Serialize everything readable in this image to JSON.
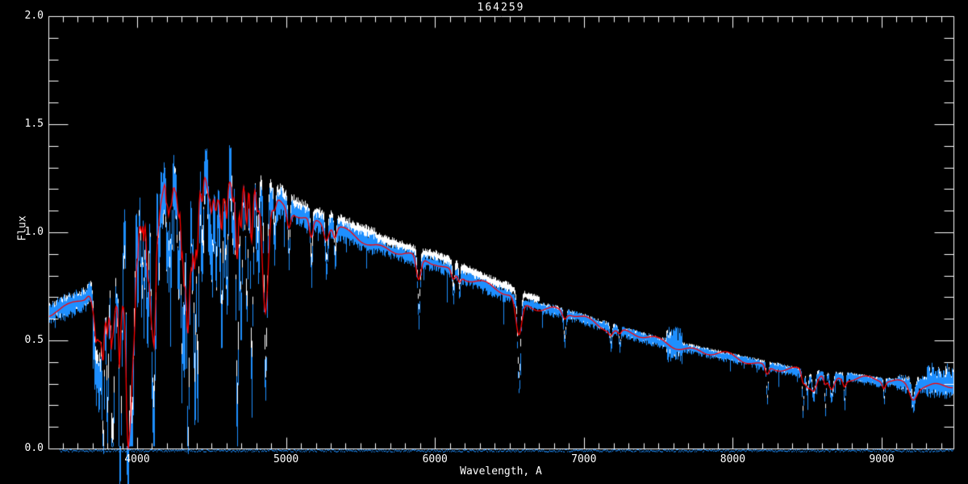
{
  "colors": {
    "background": "#000000",
    "axis": "#ffffff",
    "observed": "#1e8fff",
    "template": "#ffffff",
    "model": "#ff0000",
    "residual": "#1e8fff"
  },
  "chart_data": {
    "type": "line",
    "title": "164259",
    "xlabel": "Wavelength, A",
    "ylabel": "Flux",
    "xlim": [
      3404,
      9482
    ],
    "ylim": [
      0.0,
      2.0
    ],
    "grid": false,
    "x_major_ticks": [
      {
        "value": 4000,
        "label": "4000"
      },
      {
        "value": 5000,
        "label": "5000"
      },
      {
        "value": 6000,
        "label": "6000"
      },
      {
        "value": 7000,
        "label": "7000"
      },
      {
        "value": 8000,
        "label": "8000"
      },
      {
        "value": 9000,
        "label": "9000"
      }
    ],
    "x_minor_step": 100,
    "y_major_ticks": [
      {
        "value": 0.0,
        "label": "0.0"
      },
      {
        "value": 0.5,
        "label": "0.5"
      },
      {
        "value": 1.0,
        "label": "1.0"
      },
      {
        "value": 1.5,
        "label": "1.5"
      },
      {
        "value": 2.0,
        "label": "2.0"
      }
    ],
    "y_minor_step": 0.1,
    "series": [
      {
        "name": "observed-spectrum",
        "color": "#1e8fff",
        "style": "noisy"
      },
      {
        "name": "template-spectrum",
        "color": "#ffffff",
        "style": "noisy"
      },
      {
        "name": "model-fit",
        "color": "#ff0000",
        "style": "smooth"
      },
      {
        "name": "residual",
        "color": "#1e8fff",
        "style": "flat-near-zero"
      }
    ],
    "continuum": [
      [
        3404,
        0.62
      ],
      [
        3450,
        0.645
      ],
      [
        3500,
        0.66
      ],
      [
        3550,
        0.67
      ],
      [
        3600,
        0.685
      ],
      [
        3650,
        0.7
      ],
      [
        3700,
        0.74
      ],
      [
        3750,
        0.8
      ],
      [
        3800,
        0.88
      ],
      [
        3850,
        0.95
      ],
      [
        3900,
        1.02
      ],
      [
        3950,
        1.06
      ],
      [
        4000,
        1.12
      ],
      [
        4050,
        1.17
      ],
      [
        4100,
        1.2
      ],
      [
        4150,
        1.23
      ],
      [
        4200,
        1.25
      ],
      [
        4250,
        1.24
      ],
      [
        4300,
        1.23
      ],
      [
        4350,
        1.25
      ],
      [
        4400,
        1.27
      ],
      [
        4450,
        1.26
      ],
      [
        4500,
        1.25
      ],
      [
        4550,
        1.25
      ],
      [
        4600,
        1.26
      ],
      [
        4650,
        1.24
      ],
      [
        4700,
        1.22
      ],
      [
        4750,
        1.22
      ],
      [
        4800,
        1.21
      ],
      [
        4850,
        1.18
      ],
      [
        4900,
        1.16
      ],
      [
        4950,
        1.14
      ],
      [
        5000,
        1.12
      ],
      [
        5100,
        1.08
      ],
      [
        5200,
        1.05
      ],
      [
        5300,
        1.03
      ],
      [
        5400,
        1.0
      ],
      [
        5500,
        0.97
      ],
      [
        5600,
        0.945
      ],
      [
        5700,
        0.92
      ],
      [
        5800,
        0.9
      ],
      [
        5900,
        0.87
      ],
      [
        6000,
        0.86
      ],
      [
        6100,
        0.83
      ],
      [
        6200,
        0.795
      ],
      [
        6300,
        0.765
      ],
      [
        6400,
        0.735
      ],
      [
        6500,
        0.71
      ],
      [
        6600,
        0.675
      ],
      [
        6700,
        0.655
      ],
      [
        6800,
        0.64
      ],
      [
        6900,
        0.62
      ],
      [
        7000,
        0.6
      ],
      [
        7100,
        0.575
      ],
      [
        7200,
        0.555
      ],
      [
        7300,
        0.535
      ],
      [
        7400,
        0.515
      ],
      [
        7500,
        0.495
      ],
      [
        7600,
        0.48
      ],
      [
        7700,
        0.465
      ],
      [
        7800,
        0.45
      ],
      [
        7900,
        0.435
      ],
      [
        8000,
        0.42
      ],
      [
        8100,
        0.405
      ],
      [
        8200,
        0.39
      ],
      [
        8300,
        0.375
      ],
      [
        8400,
        0.36
      ],
      [
        8500,
        0.345
      ],
      [
        8600,
        0.34
      ],
      [
        8700,
        0.335
      ],
      [
        8800,
        0.33
      ],
      [
        9000,
        0.31
      ],
      [
        9200,
        0.3
      ],
      [
        9300,
        0.295
      ],
      [
        9482,
        0.285
      ]
    ],
    "absorption_lines": [
      [
        3712,
        8,
        0.28,
        0.1
      ],
      [
        3734,
        8,
        0.38,
        0.14
      ],
      [
        3750,
        8,
        0.4,
        0.15
      ],
      [
        3771,
        8,
        0.44,
        0.17
      ],
      [
        3798,
        9,
        0.5,
        0.2
      ],
      [
        3835,
        9,
        0.62,
        0.28
      ],
      [
        3862,
        6,
        0.32,
        0.1
      ],
      [
        3889,
        9,
        0.7,
        0.34
      ],
      [
        3933,
        8,
        0.72,
        0.55
      ],
      [
        3968,
        10,
        0.85,
        0.65
      ],
      [
        4026,
        6,
        0.32,
        0.1
      ],
      [
        4101,
        10,
        0.95,
        0.62
      ],
      [
        4144,
        6,
        0.36,
        0.12
      ],
      [
        4226,
        6,
        0.42,
        0.14
      ],
      [
        4271,
        6,
        0.33,
        0.1
      ],
      [
        4340,
        10,
        1.0,
        0.6
      ],
      [
        4383,
        6,
        0.42,
        0.15
      ],
      [
        4405,
        6,
        0.36,
        0.12
      ],
      [
        4481,
        6,
        0.28,
        0.09
      ],
      [
        4531,
        6,
        0.26,
        0.08
      ],
      [
        4668,
        6,
        0.26,
        0.08
      ],
      [
        4861,
        10,
        0.92,
        0.55
      ],
      [
        4921,
        6,
        0.22,
        0.06
      ],
      [
        5018,
        6,
        0.26,
        0.08
      ],
      [
        5169,
        6,
        0.26,
        0.09
      ],
      [
        5270,
        8,
        0.22,
        0.07
      ],
      [
        5328,
        6,
        0.17,
        0.05
      ],
      [
        5890,
        8,
        0.28,
        0.11
      ],
      [
        6122,
        6,
        0.13,
        0.04
      ],
      [
        6163,
        5,
        0.1,
        0.03
      ],
      [
        6563,
        10,
        0.42,
        0.17
      ],
      [
        6870,
        7,
        0.13,
        0.03
      ],
      [
        7180,
        6,
        0.09,
        0.02
      ],
      [
        7240,
        6,
        0.08,
        0.02
      ],
      [
        8230,
        6,
        0.17,
        0.04
      ],
      [
        8470,
        5,
        0.19,
        0.04
      ],
      [
        8498,
        9,
        0.09,
        0.06
      ],
      [
        8542,
        10,
        0.11,
        0.07
      ],
      [
        8620,
        5,
        0.17,
        0.04
      ],
      [
        8662,
        10,
        0.11,
        0.07
      ],
      [
        8750,
        5,
        0.13,
        0.03
      ],
      [
        9015,
        5,
        0.09,
        0.03
      ],
      [
        9210,
        12,
        0.09,
        0.06
      ]
    ],
    "line_forest": {
      "range": [
        3690,
        4820
      ],
      "count": 85,
      "sigma": [
        3,
        9
      ],
      "depth": [
        0.06,
        0.42
      ],
      "model_factor": 0.3,
      "template_factor": 0.85
    },
    "noise_regions": [
      [
        3404,
        3700,
        0.055,
        0.07
      ],
      [
        3700,
        3900,
        0.1,
        0.15
      ],
      [
        3900,
        4700,
        0.15,
        0.17
      ],
      [
        4700,
        5000,
        0.075,
        0.095
      ],
      [
        5000,
        5600,
        0.05,
        0.06
      ],
      [
        5600,
        6500,
        0.03,
        0.045
      ],
      [
        6500,
        7550,
        0.024,
        0.034
      ],
      [
        7550,
        7660,
        0.085,
        0.09
      ],
      [
        7660,
        9100,
        0.02,
        0.03
      ],
      [
        9100,
        9300,
        0.04,
        0.05
      ],
      [
        9300,
        9482,
        0.11,
        0.06
      ]
    ],
    "extra_dips": [
      [
        3404,
        3700,
        0.05,
        2.0
      ],
      [
        3700,
        4820,
        0.1,
        2.0
      ],
      [
        4850,
        5500,
        0.05,
        2.0
      ],
      [
        5500,
        6800,
        0.05,
        3.0
      ],
      [
        7700,
        9100,
        0.04,
        2.5
      ]
    ],
    "observed_boost": {
      "range": [
        3850,
        4800
      ],
      "factor": 1.03
    },
    "template_offset": {
      "base": 0.006,
      "range": [
        4800,
        6700
      ],
      "offset": 0.03
    },
    "residual": {
      "start_wavelength": 3480,
      "level": -0.008,
      "noise": 0.012
    },
    "noise_seed": 42
  }
}
